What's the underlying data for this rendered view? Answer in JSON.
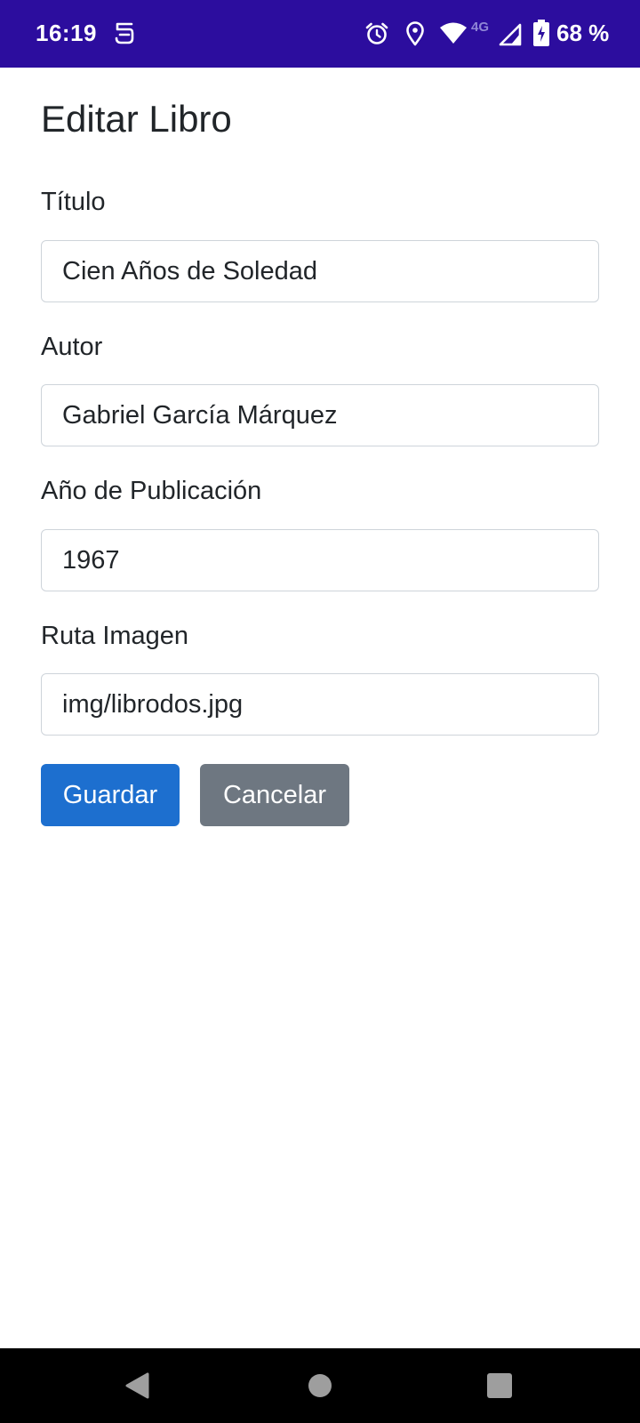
{
  "status_bar": {
    "time": "16:19",
    "network_label": "4G",
    "battery_text": "68 %",
    "icons": [
      "app-notification-icon",
      "alarm-icon",
      "location-icon",
      "wifi-icon",
      "cell-signal-icon",
      "battery-charging-icon"
    ]
  },
  "page": {
    "title": "Editar Libro"
  },
  "form": {
    "fields": [
      {
        "label": "Título",
        "value": "Cien Años de Soledad"
      },
      {
        "label": "Autor",
        "value": "Gabriel García Márquez"
      },
      {
        "label": "Año de Publicación",
        "value": "1967"
      },
      {
        "label": "Ruta Imagen",
        "value": "img/librodos.jpg"
      }
    ],
    "save_label": "Guardar",
    "cancel_label": "Cancelar"
  },
  "nav_bar": {
    "icons": [
      "back-icon",
      "home-icon",
      "recents-icon"
    ]
  },
  "colors": {
    "status_bar_bg": "#2c0d9e",
    "primary_button": "#1d6fcf",
    "secondary_button": "#6e7781",
    "input_border": "#ced4da",
    "text": "#212529"
  }
}
